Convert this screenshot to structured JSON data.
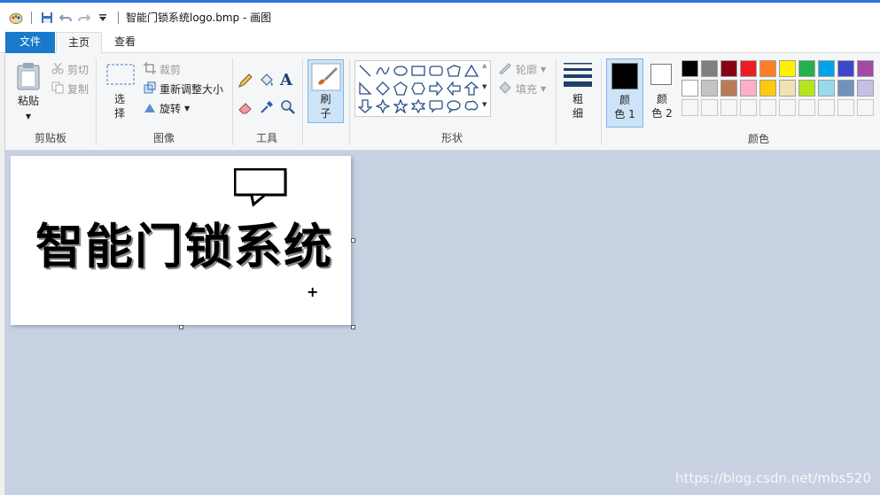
{
  "window": {
    "title": "智能门锁系统logo.bmp - 画图"
  },
  "tabs": [
    {
      "label": "文件"
    },
    {
      "label": "主页"
    },
    {
      "label": "查看"
    }
  ],
  "ribbon": {
    "clipboard": {
      "group_label": "剪贴板",
      "paste": "粘贴",
      "cut": "剪切",
      "copy": "复制"
    },
    "image": {
      "group_label": "图像",
      "select": "选\n择",
      "crop": "裁剪",
      "resize": "重新调整大小",
      "rotate": "旋转"
    },
    "tools": {
      "group_label": "工具"
    },
    "brushes": {
      "label": "刷\n子"
    },
    "shapes": {
      "group_label": "形状",
      "outline": "轮廓",
      "fill": "填充"
    },
    "size": {
      "label": "粗\n细"
    },
    "colors": {
      "group_label": "颜色",
      "color1_label": "颜\n色 1",
      "color2_label": "颜\n色 2",
      "color1": "#000000",
      "color2": "#ffffff",
      "palette_row1": [
        "#000000",
        "#7f7f7f",
        "#880015",
        "#ed1c24",
        "#ff7f27",
        "#fff200",
        "#22b14c",
        "#00a2e8",
        "#3f48cc",
        "#a349a4"
      ],
      "palette_row2": [
        "#ffffff",
        "#c3c3c3",
        "#b97a57",
        "#ffaec9",
        "#ffc90e",
        "#efe4b0",
        "#b5e61d",
        "#99d9ea",
        "#7092be",
        "#c8bfe7"
      ]
    }
  },
  "canvas": {
    "text": "智能门锁系统"
  },
  "watermark": "https://blog.csdn.net/mbs520"
}
